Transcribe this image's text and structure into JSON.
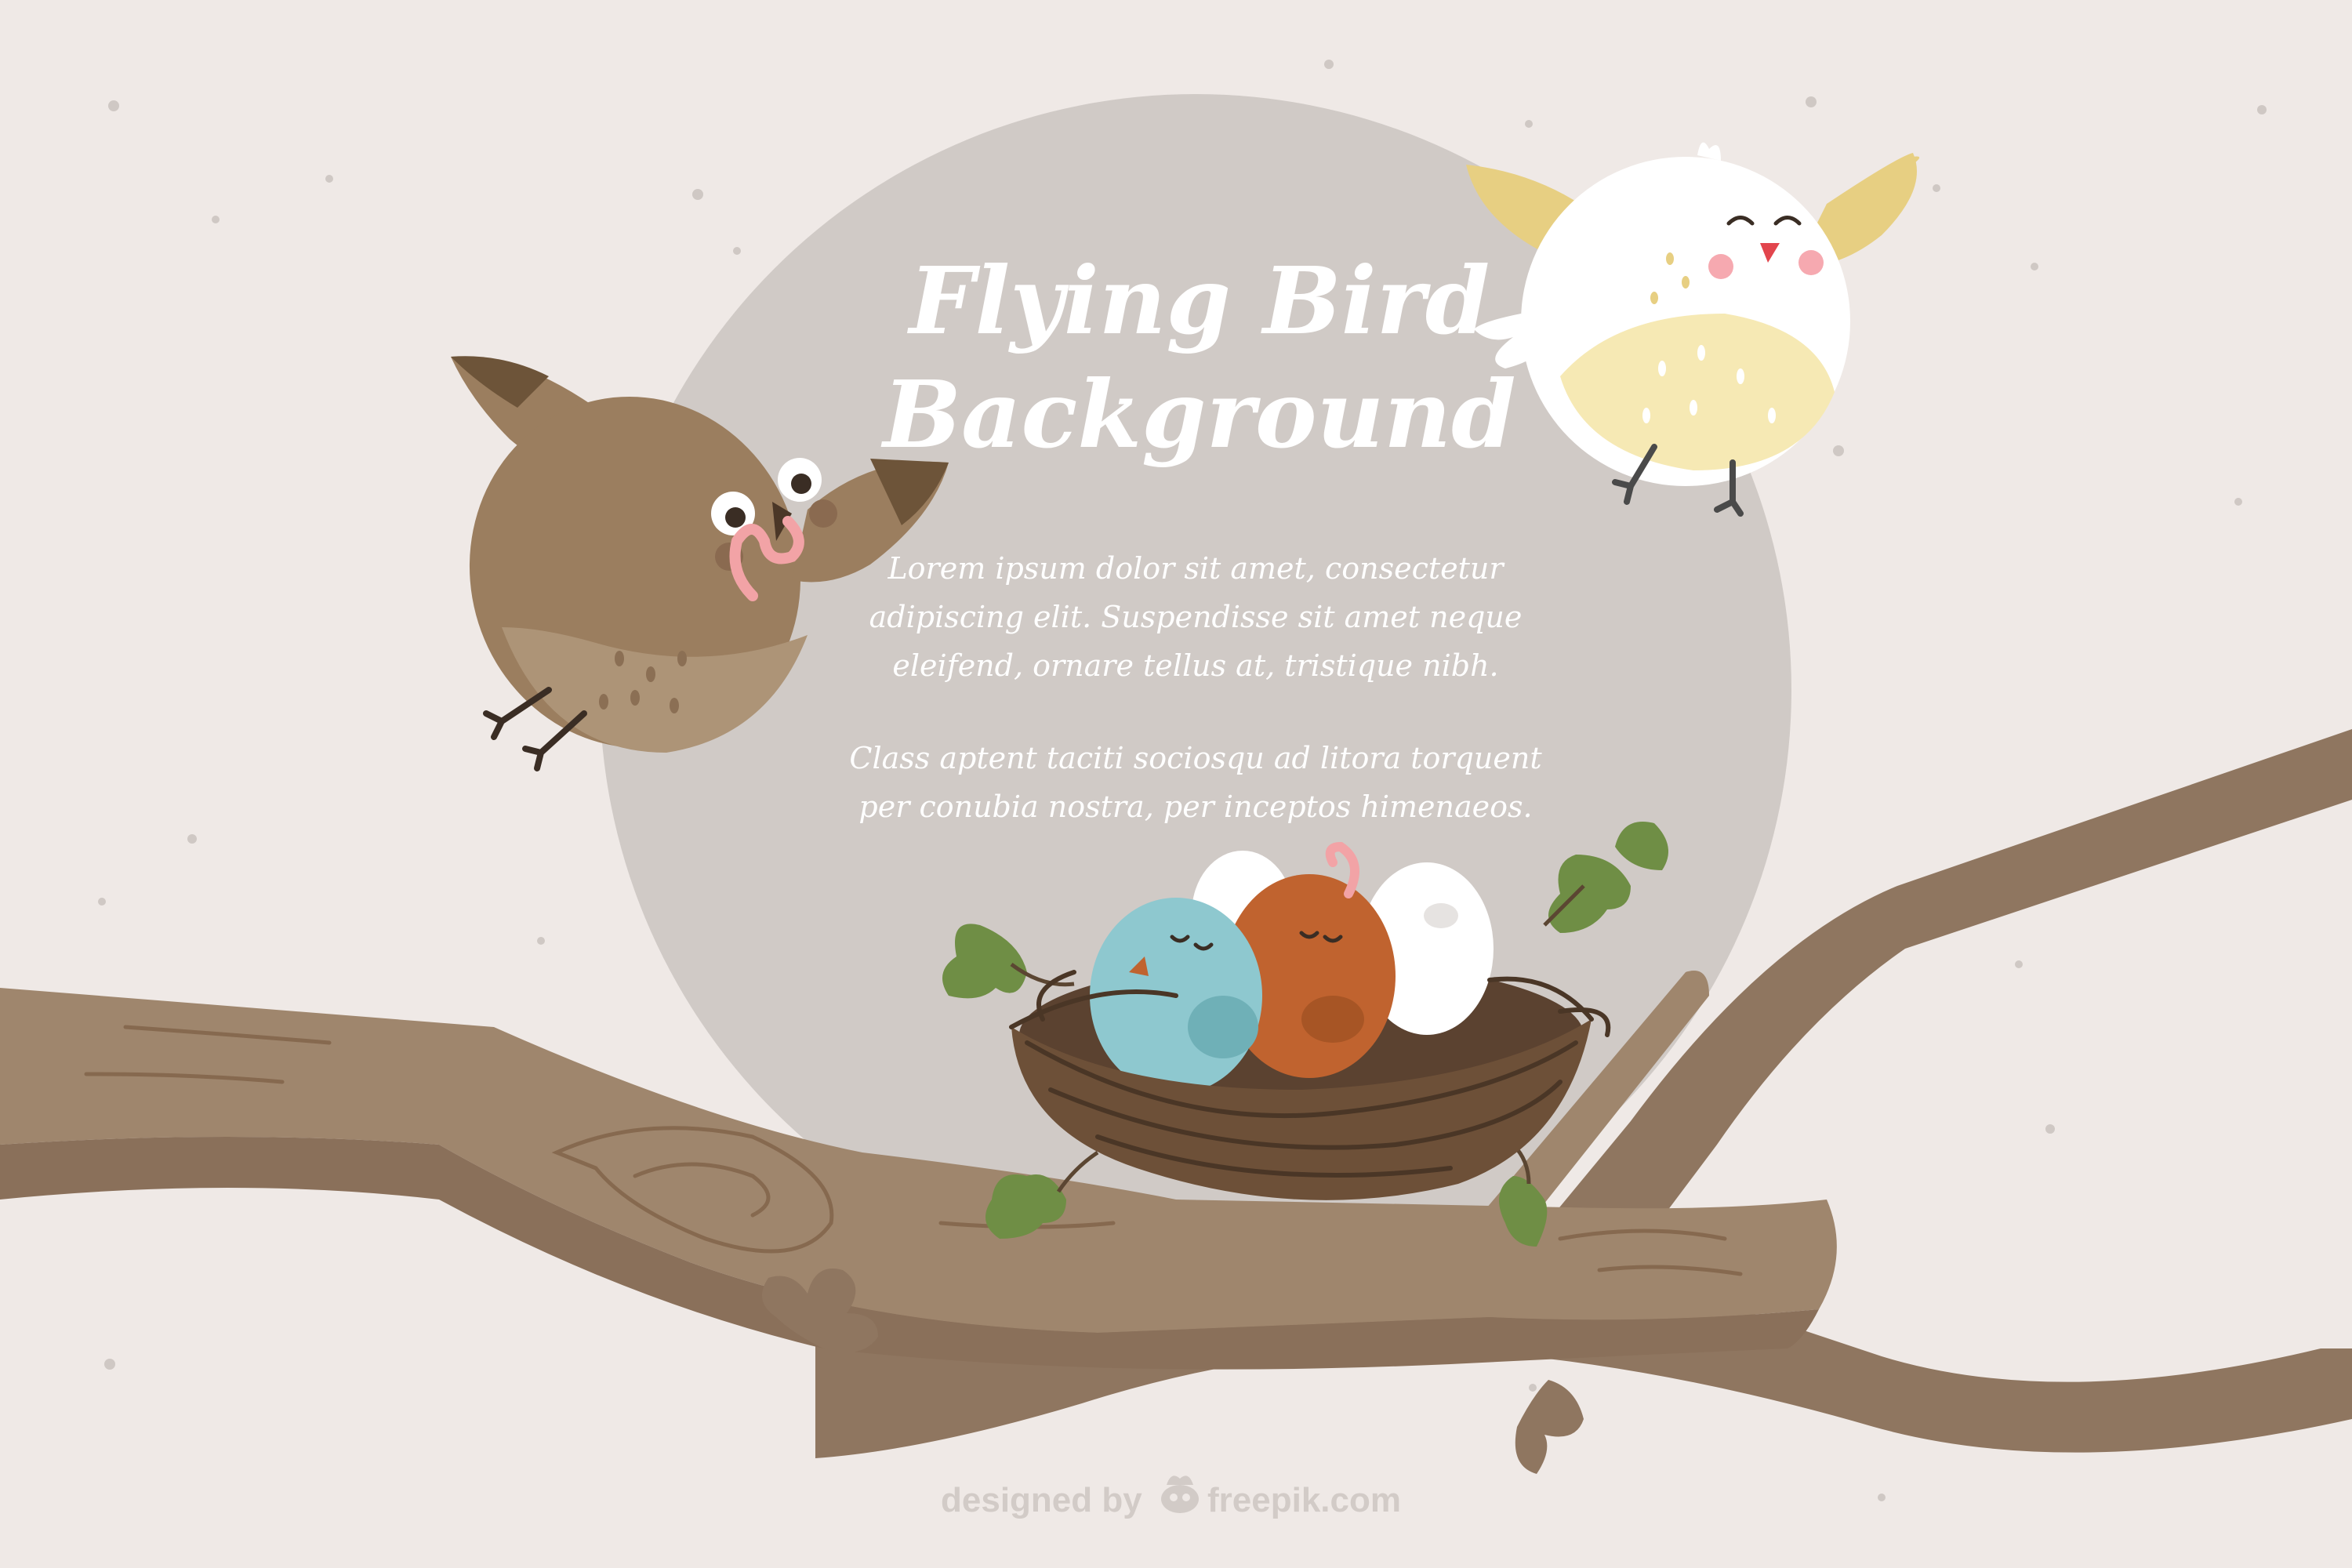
{
  "title": {
    "line1": "Flying Bird",
    "line2": "Background"
  },
  "body_text": {
    "paragraph1": [
      "Lorem ipsum dolor sit amet, consectetur",
      "adipiscing elit. Suspendisse sit amet neque",
      "eleifend, ornare tellus at, tristique nibh."
    ],
    "paragraph2": [
      "Class aptent taciti sociosqu ad litora torquent",
      "per conubia nostra, per inceptos himenaeos."
    ]
  },
  "credit": {
    "prefix": "designed by",
    "brand": "freepik.com"
  },
  "colors": {
    "background": "#efe9e6",
    "circle": "#d0cac6",
    "branch": "#8f7660",
    "branch_light": "#9f866d",
    "nest": "#6d5038",
    "text": "#ffffff"
  },
  "icons": {
    "brown_bird": "brown-bird-with-worm-icon",
    "white_bird": "white-yellow-bird-icon",
    "nest": "nest-with-eggs-and-chicks-icon",
    "credit_logo": "freepik-logo-icon"
  }
}
